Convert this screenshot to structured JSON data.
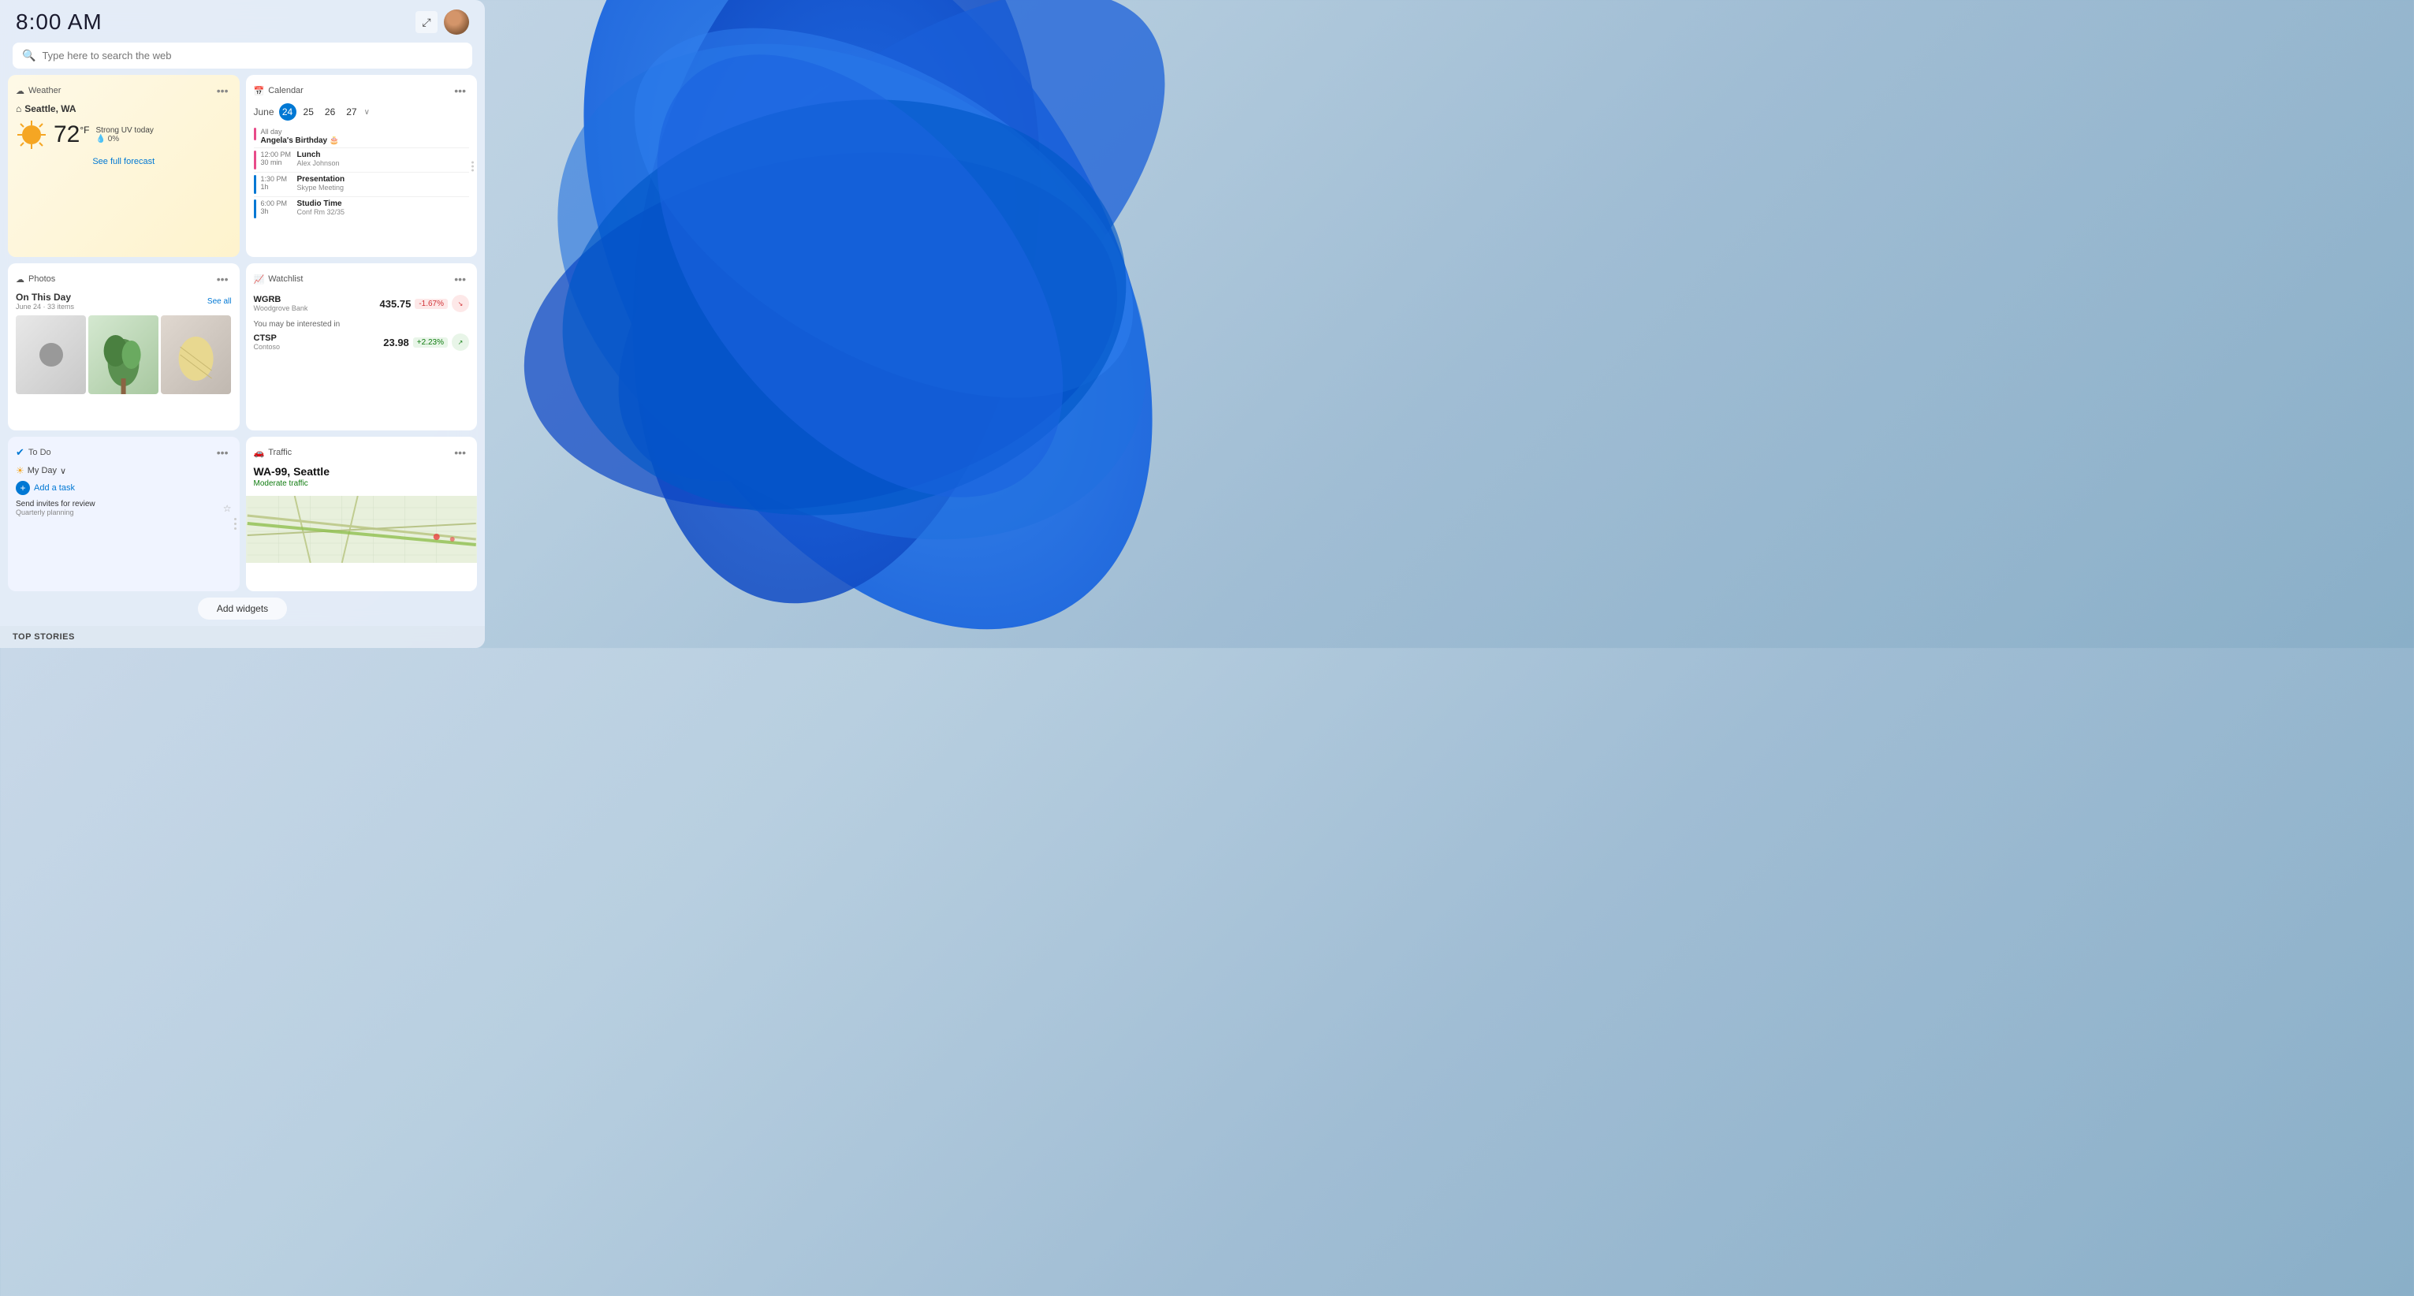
{
  "header": {
    "time": "8:00 AM",
    "expand_label": "⤢",
    "search_placeholder": "Type here to search the web"
  },
  "widgets": {
    "weather": {
      "title": "Weather",
      "location": "Seattle, WA",
      "temperature": "72",
      "unit": "°F",
      "condition": "Strong UV today",
      "precipitation": "0%",
      "forecast_link": "See full forecast"
    },
    "calendar": {
      "title": "Calendar",
      "month": "June",
      "dates": [
        "24",
        "25",
        "26",
        "27"
      ],
      "active_date": "24",
      "events": [
        {
          "type": "all_day",
          "title": "Angela's Birthday",
          "subtitle": ""
        },
        {
          "time": "12:00 PM",
          "duration": "30 min",
          "title": "Lunch",
          "subtitle": "Alex Johnson",
          "color": "#e84b8a"
        },
        {
          "time": "1:30 PM",
          "duration": "1h",
          "title": "Presentation",
          "subtitle": "Skype Meeting",
          "color": "#0078d4"
        },
        {
          "time": "6:00 PM",
          "duration": "3h",
          "title": "Studio Time",
          "subtitle": "Conf Rm 32/35",
          "color": "#0078d4"
        }
      ]
    },
    "photos": {
      "title": "Photos",
      "subtitle": "On This Day",
      "date": "June 24 · 33 items",
      "see_all": "See all"
    },
    "watchlist": {
      "title": "Watchlist",
      "stocks": [
        {
          "symbol": "WGRB",
          "name": "Woodgrove Bank",
          "price": "435.75",
          "change": "-1.67%",
          "direction": "down"
        },
        {
          "label": "You may be interested in"
        },
        {
          "symbol": "CTSP",
          "name": "Contoso",
          "price": "23.98",
          "change": "+2.23%",
          "direction": "up"
        }
      ]
    },
    "todo": {
      "title": "To Do",
      "view": "My Day",
      "add_label": "Add a task",
      "tasks": [
        {
          "title": "Send invites for review",
          "subtitle": "Quarterly planning"
        }
      ]
    },
    "traffic": {
      "title": "Traffic",
      "location": "WA-99, Seattle",
      "status": "Moderate traffic"
    }
  },
  "add_widgets_label": "Add widgets",
  "top_stories_label": "TOP STORIES",
  "icons": {
    "weather": "☁",
    "calendar": "📅",
    "photos": "☁",
    "watchlist": "📈",
    "todo": "✔",
    "traffic": "🚗",
    "search": "🔍",
    "expand": "⤢",
    "dots": "•••",
    "sun": "☀",
    "chevron_down": "∨",
    "plus": "+",
    "star": "☆",
    "home": "⌂"
  },
  "colors": {
    "accent_blue": "#0078d4",
    "panel_bg": "rgba(230,238,248,0.92)",
    "weather_bg": "#fef9e7",
    "todo_bg": "#f0f4ff",
    "neg_color": "#d13438",
    "pos_color": "#107c10",
    "swirl_blue": "#1565e0"
  }
}
